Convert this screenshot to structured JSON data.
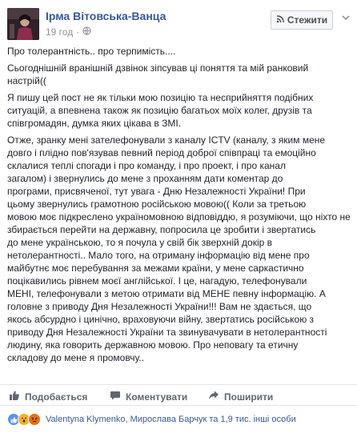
{
  "header": {
    "author": "Ірма Вітовська-Ванца",
    "time": "19 год",
    "separator": "·",
    "follow_label": "Стежити"
  },
  "post": {
    "paragraphs": [
      [
        "Про толерантність.. про терпимість...."
      ],
      [
        "Сьогоднішній вранішній дзвінок зіпсував ці поняття та мій ранковий",
        "настрій(("
      ],
      [
        "Я пишу цей пост не як тільки мою позицію та несприйняття подібних",
        "ситуацій, а впевнена також як позицію багатьох моїх колег, друзів та",
        "співгромадян, думка яких цікава в ЗМІ."
      ],
      [
        "Отже, зранку мені зателефонували з каналу ICTV (каналу, з яким мене",
        "довго і плідно пов'язував певний період доброї співпраці та емоційно",
        "склалися теплі спогади і про команду, і про проект, і про канал",
        "загалом) і звернулись до мене з проханням дати коментар до",
        "програми, присвяченої, тут увага - Дню Незалежності України! При",
        "цьому звернулись грамотною російською мовою(( Коли за третьою",
        "мовою моє підкреслено україномовною відповіддю, я розуміючи, що ніхто не",
        "збирається перейти на державну, попросила це зробити і звертатись",
        "до мене українською, то я почула у свій бік зверхній докір в",
        "нетолерантності.. Мало того, на отриману інформацію від мене про",
        "майбутнє моє перебування за межами країни, у мене саркастично",
        "поцікавились рівнем моєї англійської. І це, нагадую, телефонували",
        "МЕНІ, телефонували з метою отримати від МЕНЕ певну інформацію. А",
        "головне з приводу Дня Незалежності України!!! Вам не здається, що",
        "якось абсурдно і цинічно, враховуючи війну, звертатись російською з",
        "приводу Дня Незалежності України та звинувачувати в нетолерантності",
        "людину, яка говорить державною мовою. Про неповагу та етичну",
        "складову до мене я промовчу.."
      ]
    ]
  },
  "actions": {
    "like": "Подобається",
    "comment": "Коментувати",
    "share": "Поширити"
  },
  "reactions": {
    "names": "Valentyna Klymenko, Мирослава Барчук та 1,9 тис. інші особи"
  },
  "colors": {
    "link": "#365899",
    "text": "#1d2129",
    "muted": "#90949c"
  }
}
